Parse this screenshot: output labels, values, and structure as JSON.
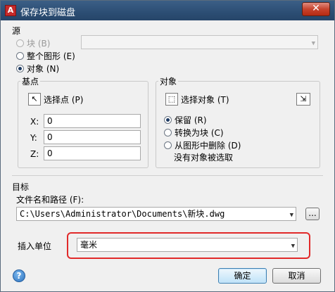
{
  "window": {
    "title": "保存块到磁盘",
    "close_glyph": "✕",
    "app_glyph": "A"
  },
  "source": {
    "heading": "源",
    "radio_block": "块 (B)",
    "radio_whole": "整个图形 (E)",
    "radio_objects": "对象 (N)",
    "selected": "objects",
    "block_combo_value": ""
  },
  "basepoint": {
    "heading": "基点",
    "pick_label": "选择点 (P)",
    "x_label": "X:",
    "y_label": "Y:",
    "z_label": "Z:",
    "x_value": "0",
    "y_value": "0",
    "z_value": "0"
  },
  "objects": {
    "heading": "对象",
    "select_label": "选择对象 (T)",
    "radio_retain": "保留 (R)",
    "radio_convert": "转换为块 (C)",
    "radio_delete": "从图形中删除 (D)",
    "selected": "retain",
    "status": "没有对象被选取"
  },
  "target": {
    "heading": "目标",
    "path_label": "文件名和路径 (F):",
    "path_value": "C:\\Users\\Administrator\\Documents\\新块.dwg",
    "browse_label": "...",
    "units_label": "插入单位",
    "units_value": "毫米"
  },
  "footer": {
    "ok_label": "确定",
    "cancel_label": "取消",
    "help_glyph": "?"
  },
  "colors": {
    "highlight": "#e12a2a",
    "titlebar": "#2c4e74"
  }
}
